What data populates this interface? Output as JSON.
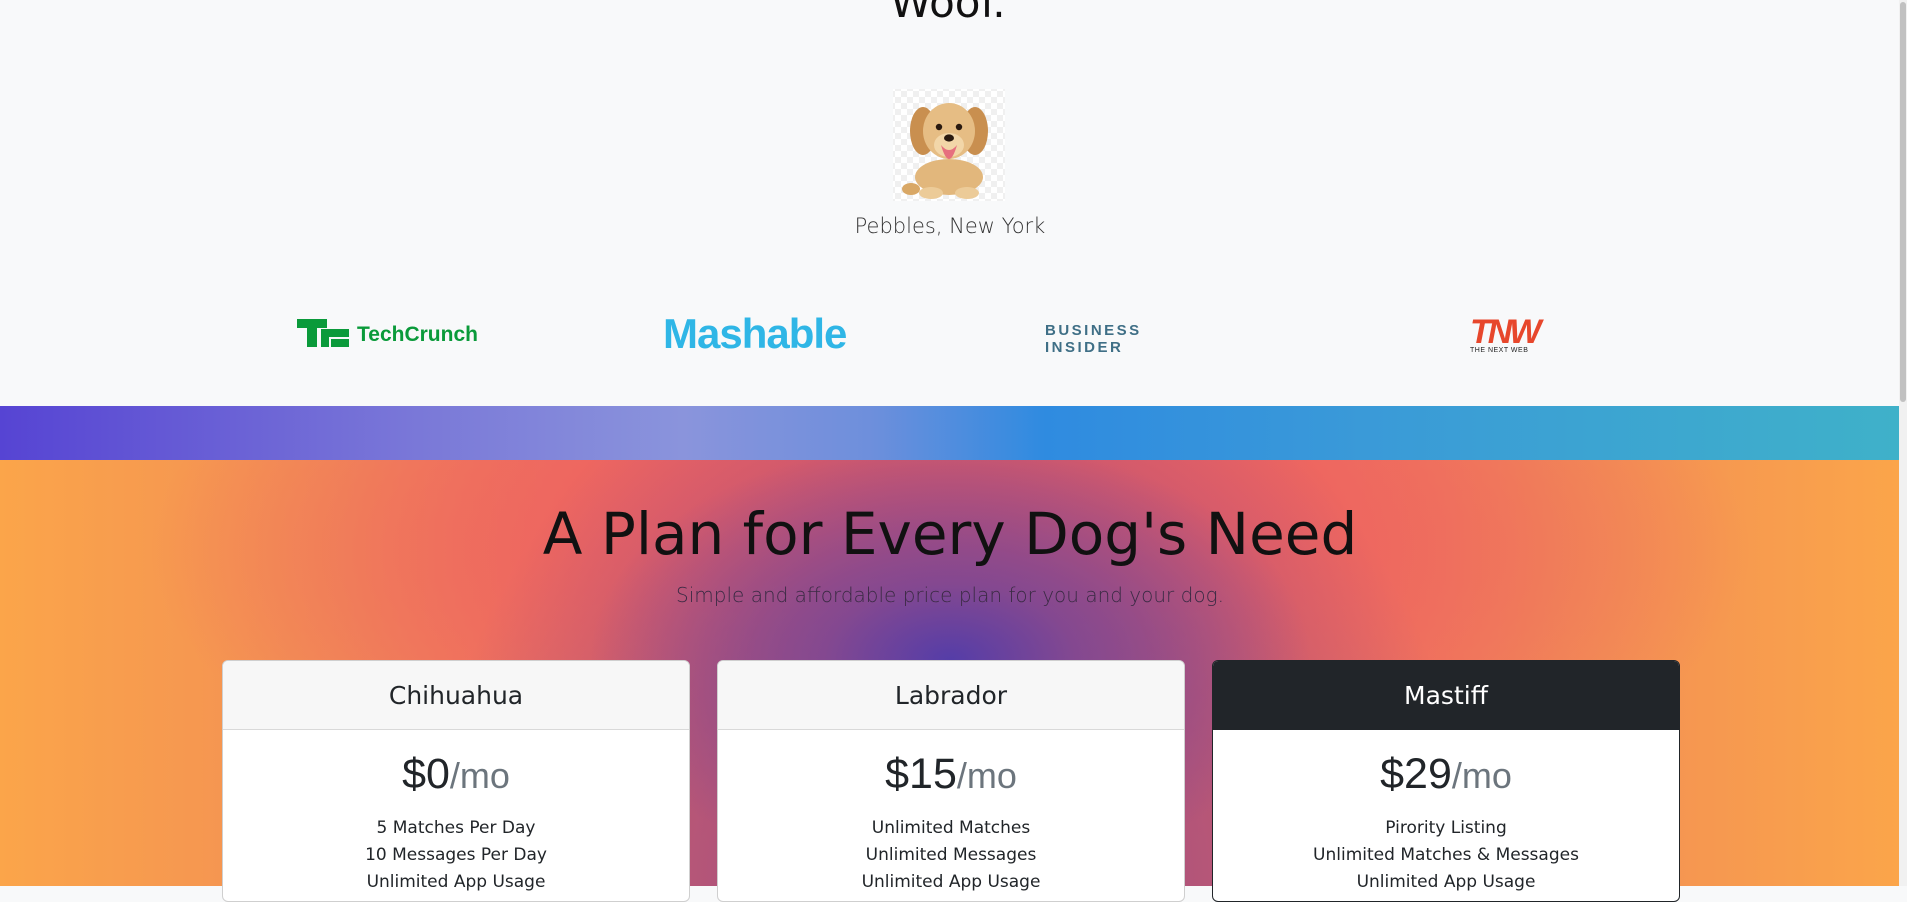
{
  "testimonial": {
    "author": "Pebbles, New York",
    "title_fragment": "Woof."
  },
  "press": {
    "logos": [
      "TechCrunch",
      "Mashable",
      "BUSINESS INSIDER",
      "TNW"
    ],
    "tnw_sub": "THE NEXT WEB"
  },
  "pricing": {
    "title": "A Plan for Every Dog's Need",
    "subtitle": "Simple and affordable price plan for you and your dog.",
    "plans": [
      {
        "name": "Chihuahua",
        "price": "$0",
        "unit": "/mo",
        "features": [
          "5 Matches Per Day",
          "10 Messages Per Day",
          "Unlimited App Usage"
        ]
      },
      {
        "name": "Labrador",
        "price": "$15",
        "unit": "/mo",
        "features": [
          "Unlimited Matches",
          "Unlimited Messages",
          "Unlimited App Usage"
        ]
      },
      {
        "name": "Mastiff",
        "price": "$29",
        "unit": "/mo",
        "features": [
          "Pirority Listing",
          "Unlimited Matches & Messages",
          "Unlimited App Usage"
        ]
      }
    ]
  },
  "colors": {
    "band_start": "#5644d3",
    "band_end": "#3fb1c9",
    "pricing_edge": "#fba54a",
    "pricing_center": "#8b4b8e",
    "featured_header": "#212529"
  }
}
